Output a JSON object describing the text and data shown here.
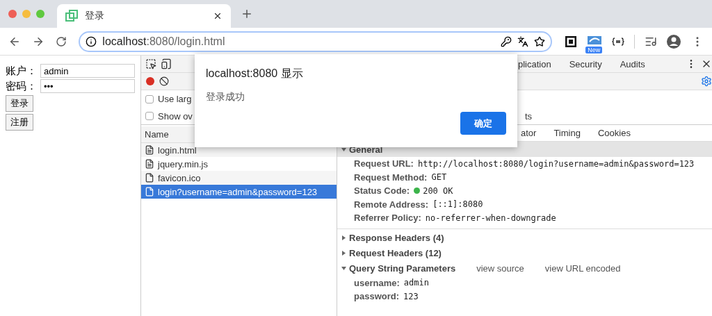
{
  "browser_tab": {
    "title": "登录",
    "selected": true
  },
  "address_bar": {
    "url_host": "localhost",
    "url_path": ":8080/login.html"
  },
  "extension_badge": "New",
  "page": {
    "fields": [
      {
        "label": "账户：",
        "value": "admin"
      },
      {
        "label": "密码：",
        "value": "•••"
      }
    ],
    "buttons": [
      "登录",
      "注册"
    ]
  },
  "devtools": {
    "tabs": [
      {
        "label": "plication",
        "selected": false
      },
      {
        "label": "Security",
        "selected": false
      },
      {
        "label": "Audits",
        "selected": false
      }
    ],
    "options": [
      {
        "label": "Use larg",
        "checked": false
      },
      {
        "label": "Show ov",
        "checked": false,
        "tail": "ts"
      }
    ],
    "list_header": "Name",
    "requests": [
      {
        "name": "login.html",
        "selected": false
      },
      {
        "name": "jquery.min.js",
        "selected": false
      },
      {
        "name": "favicon.ico",
        "selected": false
      },
      {
        "name": "login?username=admin&password=123",
        "selected": true
      }
    ],
    "detail_tabs": [
      {
        "label": "ator",
        "selected": false
      },
      {
        "label": "Timing",
        "selected": false
      },
      {
        "label": "Cookies",
        "selected": false
      }
    ],
    "sections": [
      {
        "title": "General",
        "expanded": true,
        "rows": [
          {
            "key": "Request URL:",
            "value": "http://localhost:8080/login?username=admin&password=123"
          },
          {
            "key": "Request Method:",
            "value": "GET"
          },
          {
            "key": "Status Code:",
            "value": "200 OK",
            "color": "#3cb44b"
          },
          {
            "key": "Remote Address:",
            "value": "[::1]:8080"
          },
          {
            "key": "Referrer Policy:",
            "value": "no-referrer-when-downgrade"
          }
        ]
      },
      {
        "title": "Response Headers (4)",
        "expanded": false
      },
      {
        "title": "Request Headers (12)",
        "expanded": false
      },
      {
        "title": "Query String Parameters",
        "expanded": true,
        "links": [
          "view source",
          "view URL encoded"
        ],
        "rows": [
          {
            "key": "username:",
            "value": "admin"
          },
          {
            "key": "password:",
            "value": "123"
          }
        ]
      }
    ]
  },
  "dialog": {
    "title": "localhost:8080 显示",
    "message": "登录成功",
    "button": "确定"
  }
}
